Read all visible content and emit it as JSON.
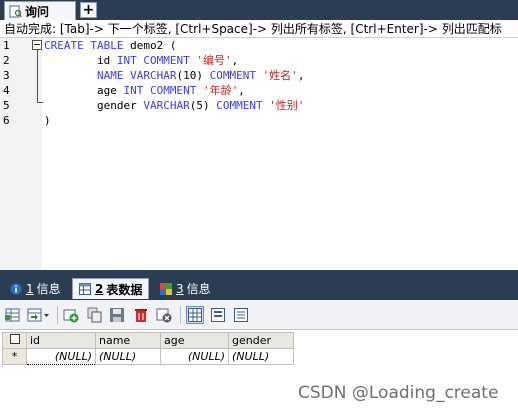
{
  "tabs": {
    "query_label": "询问",
    "add_symbol": "+"
  },
  "hint": "自动完成: [Tab]-> 下一个标签, [Ctrl+Space]-> 列出所有标签, [Ctrl+Enter]-> 列出匹配标",
  "editor": {
    "line_numbers": [
      "1",
      "2",
      "3",
      "4",
      "5",
      "6"
    ],
    "lines": [
      [
        {
          "t": "CREATE TABLE ",
          "c": "kw"
        },
        {
          "t": "demo2 (",
          "c": "plain"
        }
      ],
      [
        {
          "t": "        id ",
          "c": "plain"
        },
        {
          "t": "INT COMMENT ",
          "c": "kw"
        },
        {
          "t": "'编号'",
          "c": "str"
        },
        {
          "t": ",",
          "c": "plain"
        }
      ],
      [
        {
          "t": "        NAME VARCHAR",
          "c": "kw"
        },
        {
          "t": "(10) ",
          "c": "plain"
        },
        {
          "t": "COMMENT ",
          "c": "kw"
        },
        {
          "t": "'姓名'",
          "c": "str"
        },
        {
          "t": ",",
          "c": "plain"
        }
      ],
      [
        {
          "t": "        age ",
          "c": "plain"
        },
        {
          "t": "INT COMMENT ",
          "c": "kw"
        },
        {
          "t": "'年龄'",
          "c": "str"
        },
        {
          "t": ",",
          "c": "plain"
        }
      ],
      [
        {
          "t": "        gender ",
          "c": "plain"
        },
        {
          "t": "VARCHAR",
          "c": "kw"
        },
        {
          "t": "(5) ",
          "c": "plain"
        },
        {
          "t": "COMMENT ",
          "c": "kw"
        },
        {
          "t": "'性别'",
          "c": "str"
        }
      ],
      [
        {
          "t": ")",
          "c": "plain"
        }
      ]
    ]
  },
  "result_tabs": [
    {
      "num": "1",
      "label": "信息",
      "icon": "info-icon",
      "active": false
    },
    {
      "num": "2",
      "label": "表数据",
      "icon": "table-data-icon",
      "active": true
    },
    {
      "num": "3",
      "label": "信息",
      "icon": "info-icon",
      "active": false
    }
  ],
  "grid": {
    "columns": [
      "id",
      "name",
      "age",
      "gender"
    ],
    "rows": [
      {
        "marker": "*",
        "cells": [
          "(NULL)",
          "(NULL)",
          "(NULL)",
          "(NULL)"
        ]
      }
    ]
  },
  "watermark": "CSDN @Loading_create",
  "colors": {
    "keyword": "#3a3aff",
    "string": "#c0241c",
    "chrome": "#2b3d52"
  }
}
